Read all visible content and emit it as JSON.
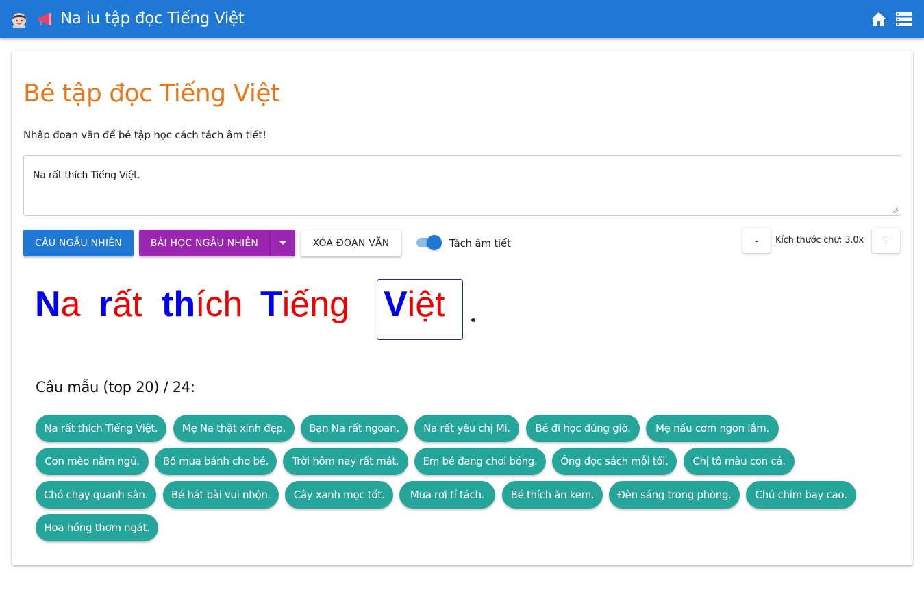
{
  "appbar": {
    "title": "Na iu tập đọc Tiếng Việt",
    "icons": [
      "girl-avatar-icon",
      "megaphone-icon",
      "home-icon",
      "list-icon"
    ]
  },
  "main": {
    "heading": "Bé tập đọc Tiếng Việt",
    "description": "Nhập đoạn văn để bé tập học cách tách âm tiết!",
    "textarea_value": "Na rất thích Tiếng Việt.",
    "buttons": {
      "random_sentence": "CÂU NGẪU NHIÊN",
      "random_lesson": "BÀI HỌC NGẪU NHIÊN",
      "clear": "XÓA ĐOẠN VĂN"
    },
    "toggle": {
      "label": "Tách âm tiết",
      "checked": true
    },
    "font_size": {
      "minus": "-",
      "plus": "+",
      "label": "Kích thước chữ: 3.0x"
    },
    "reading": {
      "words": [
        {
          "onset": "N",
          "rhyme": "a"
        },
        {
          "onset": "r",
          "rhyme": "ất"
        },
        {
          "onset": "th",
          "rhyme": "ích"
        },
        {
          "onset": "T",
          "rhyme": "iếng"
        },
        {
          "onset": "V",
          "rhyme": "iệt"
        }
      ],
      "onset_color": "#0000ee",
      "rhyme_color": "#ee0000",
      "selected_index": 4
    },
    "samples": {
      "title": "Câu mẫu (top 20) / 24:",
      "items": [
        "Na rất thích Tiếng Việt.",
        "Mẹ Na thật xinh đẹp.",
        "Bạn Na rất ngoan.",
        "Na rất yêu chị Mi.",
        "Bé đi học đúng giờ.",
        "Mẹ nấu cơm ngon lắm.",
        "Con mèo nằm ngủ.",
        "Bố mua bánh cho bé.",
        "Trời hôm nay rất mát.",
        "Em bé đang chơi bóng.",
        "Ông đọc sách mỗi tối.",
        "Chị tô màu con cá.",
        "Chó chạy quanh sân.",
        "Bé hát bài vui nhộn.",
        "Cây xanh mọc tốt.",
        "Mưa rơi tí tách.",
        "Bé thích ăn kem.",
        "Đèn sáng trong phòng.",
        "Chú chim bay cao.",
        "Hoa hồng thơm ngát."
      ]
    }
  },
  "colors": {
    "primary": "#1e78d4",
    "lesson_button": "#9b27b0",
    "heading": "#e8771c",
    "chip": "#26a59a"
  }
}
